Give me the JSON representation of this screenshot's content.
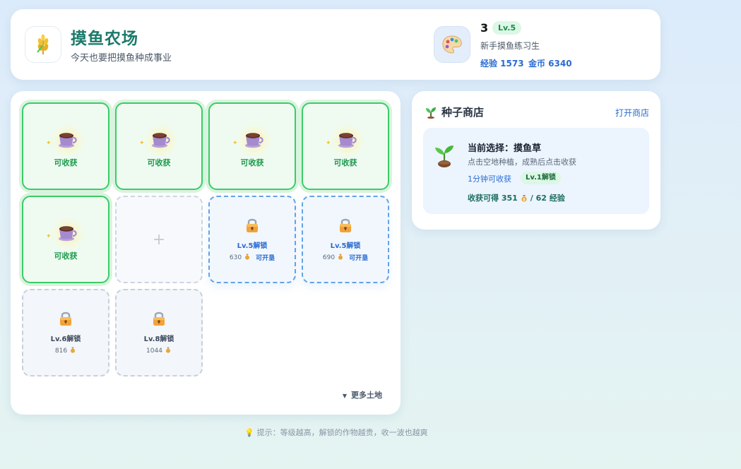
{
  "header": {
    "title": "摸鱼农场",
    "subtitle": "今天也要把摸鱼种成事业",
    "logo_icon": "wheat-icon"
  },
  "user": {
    "avatar_icon": "palette-icon",
    "name": "3",
    "level": "Lv.5",
    "title": "新手摸鱼练习生",
    "exp": "经验 1573",
    "gold": "金币 6340"
  },
  "farm": {
    "ready_label": "可收获",
    "crop_icon": "coffee-cup-icon",
    "plots": [
      {
        "state": "ready"
      },
      {
        "state": "ready"
      },
      {
        "state": "ready"
      },
      {
        "state": "ready"
      },
      {
        "state": "ready"
      },
      {
        "state": "empty",
        "symbol": "+"
      },
      {
        "state": "unlockable",
        "label": "Lv.5解锁",
        "cost": "630",
        "action": "可开垦"
      },
      {
        "state": "unlockable",
        "label": "Lv.5解锁",
        "cost": "690",
        "action": "可开垦"
      },
      {
        "state": "locked",
        "label": "Lv.6解锁",
        "cost": "816"
      },
      {
        "state": "locked",
        "label": "Lv.8解锁",
        "cost": "1044"
      }
    ],
    "more_label": "更多土地"
  },
  "shop": {
    "title": "种子商店",
    "open_label": "打开商店",
    "current": "当前选择：摸鱼草",
    "hint": "点击空地种植，成熟后点击收获",
    "time": "1分钟可收获",
    "unlock_badge": "Lv.1解锁",
    "reward_prefix": "收获可得 351",
    "reward_suffix": "/ 62 经验"
  },
  "tip": "提示：等级越高，解锁的作物越贵，收一波也越爽",
  "colors": {
    "accent_green": "#3ccb67",
    "accent_blue": "#2a6bd1",
    "title_teal": "#1b7a6a"
  }
}
